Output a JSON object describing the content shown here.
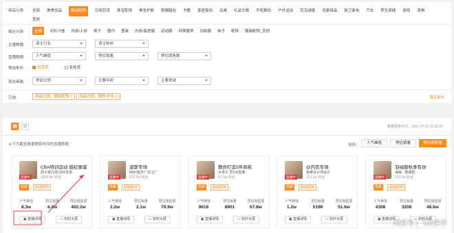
{
  "filters": {
    "category_label": "商品分类:",
    "categories": [
      "全部",
      "美食饮品",
      "服装配饰",
      "日用百货",
      "珠宝配饰",
      "美妆护肤",
      "鞋帽箱包",
      "书籍",
      "家居家纺",
      "玩具",
      "礼品文娱",
      "手机数码",
      "户外运动",
      "花鸟绿植",
      "母婴用品",
      "厨卫家电",
      "汽车",
      "养生保健",
      "游戏",
      "宠物"
    ],
    "categories_extra": "其他",
    "sub_label": "细分分类:",
    "subs": [
      "全部",
      "衬衫/T恤",
      "内衣/上衣",
      "裤子",
      "围巾",
      "童装",
      "内衣/家居服",
      "运动服",
      "特殊服饰",
      "羽绒服",
      "袜子",
      "配饰",
      "服装配饰_其他"
    ],
    "anchor_label": "主播数据:",
    "anchor_dd": [
      "请主行业",
      "请主粉丝"
    ],
    "live_label": "直播数据:",
    "live_dd": [
      "人气峰值",
      "预估销量",
      "预估销售额"
    ],
    "cond_label": "筛选条件:",
    "cond": [
      "有带货",
      "有挂货"
    ],
    "audience_label": "观众画像:",
    "audience_dd": [
      "男女比例",
      "主要年龄",
      "主要地域"
    ],
    "selected_label": "已选:",
    "selected": [
      "商品分类：服装配饰 ×",
      "商品分类：服饰/羊毛 ×"
    ],
    "clear": "清空条件"
  },
  "toolbar": {
    "update_time": "数据更新时间：2021-07-23 11:00:00",
    "hint": "以下为截至数据更新时间的直播数据",
    "sort_label": "排序：",
    "sorts": [
      "人气峰值",
      "预估销量",
      "预估销售额"
    ]
  },
  "cards": [
    {
      "name": "CBA特训运动 城纪录城",
      "sub": "周子家21年CBA专场",
      "fans": "1056.8w 粉丝",
      "badge": "直播中",
      "tags": [
        "热卖",
        "服装配饰"
      ],
      "metric_labels": [
        "人气峰值",
        "预估销量",
        "预估销售额"
      ],
      "metrics": [
        "8.3w",
        "6.4w",
        "402.2w"
      ],
      "btn1": "直播详情",
      "btn2": "实时大屏"
    },
    {
      "name": "波斯专场",
      "sub": "MM#室外厂店工厂",
      "fans": "672.0w 粉丝",
      "badge": "直播中",
      "tags": [
        "热卖",
        "服装配饰"
      ],
      "metric_labels": [
        "人气峰值",
        "预估销量",
        "预估销售额"
      ],
      "metrics": [
        "2.2w",
        "2.1w",
        "79.9w"
      ],
      "btn1": "直播详情",
      "btn2": "实时大屏"
    },
    {
      "name": "教你打造5件商练",
      "sub": "大翠子 早5点直播",
      "fans": "52.0w 粉丝",
      "badge": "直播中",
      "tags": [
        "热卖",
        "服装配饰"
      ],
      "metric_labels": [
        "人气峰值",
        "预估销量",
        "预估销售额"
      ],
      "metrics": [
        "9618",
        "8901",
        "67.8w"
      ],
      "btn1": "直播详情",
      "btn2": "实时大屏"
    },
    {
      "name": "@内衣专场",
      "sub": "金螺设计师设计",
      "fans": "323.2w 粉丝",
      "badge": "直播中",
      "tags": [
        "热卖",
        "服装配饰"
      ],
      "metric_labels": [
        "人气峰值",
        "预估销量",
        "预估销售额"
      ],
      "metrics": [
        "1.2w",
        "5196",
        "51.6w"
      ],
      "btn1": "直播详情",
      "btn2": "实时大屏"
    },
    {
      "name": "羽绒服秋季有你",
      "sub": "海美 · 数媒配",
      "fans": "223.0w 粉丝",
      "badge": "直播中",
      "tags": [
        "热卖",
        "服装配饰"
      ],
      "metric_labels": [
        "人气峰值",
        "预估销量",
        "预估销售额"
      ],
      "metrics": [
        "4308",
        "3208",
        "48.6w"
      ],
      "btn1": "直播详情",
      "btn2": "实时大屏"
    }
  ],
  "watermark": "网易号 | 飞瓜快手",
  "colors": {
    "accent": "#ff8a1f",
    "live": "#e8393d",
    "annotation": "#e23c3c"
  }
}
